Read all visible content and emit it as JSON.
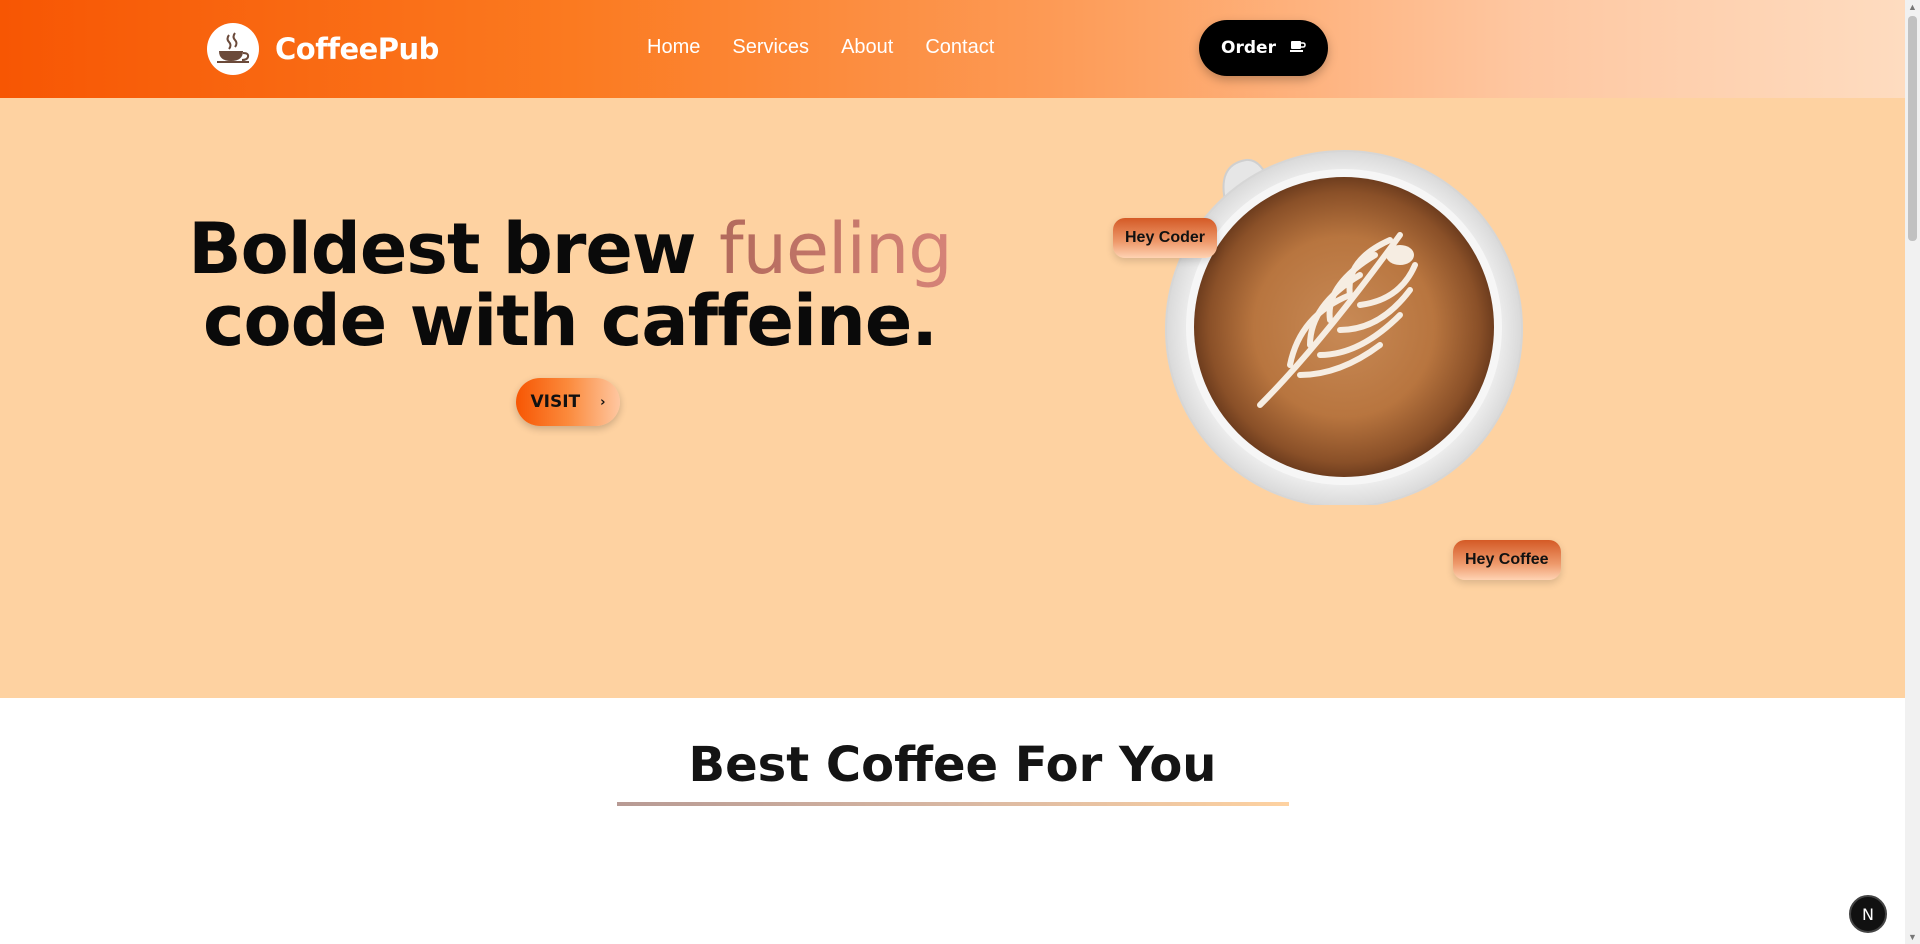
{
  "brand": {
    "name": "CoffeePub",
    "logo_icon": "coffee-cup-steam-icon"
  },
  "nav": {
    "items": [
      {
        "label": "Home"
      },
      {
        "label": "Services"
      },
      {
        "label": "About"
      },
      {
        "label": "Contact"
      }
    ]
  },
  "header": {
    "order_label": "Order",
    "order_icon": "coffee-cup-icon"
  },
  "hero": {
    "headline_part1": "Boldest brew ",
    "headline_accent": "fueling",
    "headline_part2": "code with caffeine.",
    "visit_label": "VISIT",
    "visit_icon": "chevron-right-icon",
    "tag_top": "Hey Coder",
    "tag_bottom": "Hey Coffee",
    "image": "latte-art-coffee-cup"
  },
  "section": {
    "title": "Best Coffee For You"
  },
  "overlay": {
    "badge_letter": "N"
  },
  "colors": {
    "accent_orange": "#f75603",
    "hero_bg": "#fed2a1",
    "dark": "#000000"
  }
}
